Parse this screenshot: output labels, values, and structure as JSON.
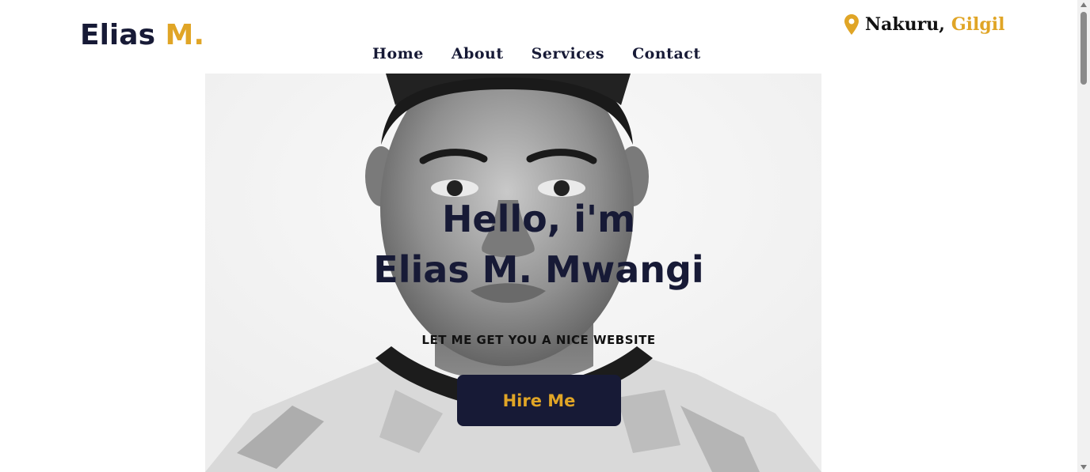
{
  "brand": {
    "name": "Elias",
    "accent": "M."
  },
  "location": {
    "icon": "map-pin-icon",
    "city": "Nakuru,",
    "area": "Gilgil"
  },
  "nav": {
    "items": [
      {
        "label": "Home"
      },
      {
        "label": "About"
      },
      {
        "label": "Services"
      },
      {
        "label": "Contact"
      }
    ]
  },
  "hero": {
    "greeting": "Hello, i'm",
    "name": "Elias M. Mwangi",
    "tagline": "LET ME GET YOU A NICE WEBSITE",
    "cta_label": "Hire Me"
  },
  "colors": {
    "primary": "#171a36",
    "accent": "#e0a526",
    "background": "#ffffff"
  }
}
